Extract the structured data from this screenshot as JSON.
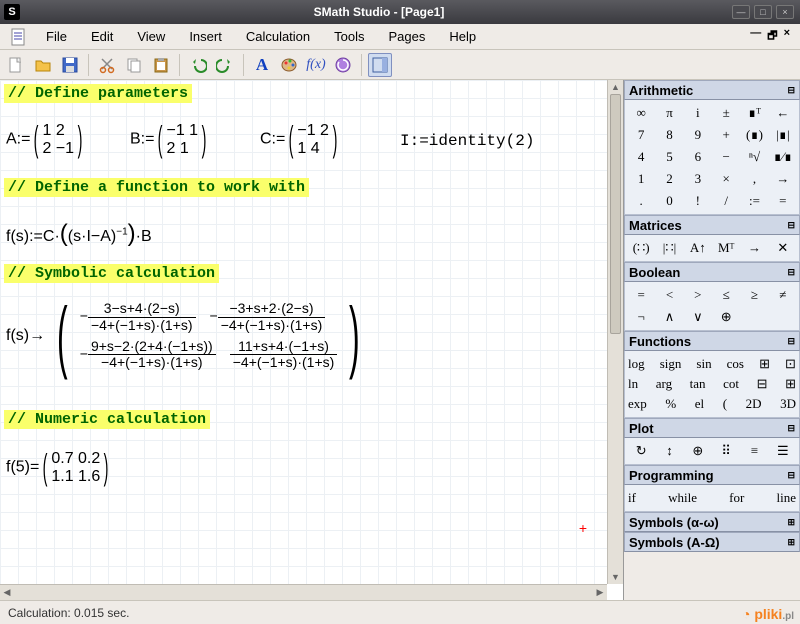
{
  "title": "SMath Studio - [Page1]",
  "menu": [
    "File",
    "Edit",
    "View",
    "Insert",
    "Calculation",
    "Tools",
    "Pages",
    "Help"
  ],
  "status": "Calculation: 0.015 sec.",
  "watermark": {
    "brand": "pliki",
    "tld": ".pl"
  },
  "comments": {
    "c1": "// Define parameters",
    "c2": "// Define a function to work with",
    "c3": "// Symbolic calculation",
    "c4": "// Numeric calculation"
  },
  "matrices": {
    "A": {
      "label": "A:=",
      "r1": "1  2",
      "r2": "2 −1"
    },
    "B": {
      "label": "B:=",
      "r1": "−1 1",
      "r2": " 2 1"
    },
    "C": {
      "label": "C:=",
      "r1": "−1 2",
      "r2": " 1 4"
    },
    "I": "I:=identity(2)"
  },
  "fdef": {
    "lhs": "f(s):=C·",
    "mid": "(s·I−A)",
    "exp": "−1",
    "tail": "·B"
  },
  "fsym": {
    "lhs": "f(s)→",
    "m11n": "3−s+4·(2−s)",
    "m11d": "−4+(−1+s)·(1+s)",
    "m11s": "−",
    "m12n": "−3+s+2·(2−s)",
    "m12d": "−4+(−1+s)·(1+s)",
    "m12s": "−",
    "m21n": "9+s−2·(2+4·(−1+s))",
    "m21d": "−4+(−1+s)·(1+s)",
    "m21s": "−",
    "m22n": "11+s+4·(−1+s)",
    "m22d": "−4+(−1+s)·(1+s)",
    "m22s": ""
  },
  "fnum": {
    "lhs": "f(5)=",
    "r1": "0.7 0.2",
    "r2": "1.1 1.6"
  },
  "palettes": {
    "arithmetic": {
      "title": "Arithmetic",
      "cells": [
        "∞",
        "π",
        "i",
        "±",
        "∎ᵀ",
        "←",
        "7",
        "8",
        "9",
        "+",
        "(∎)",
        "|∎|",
        "4",
        "5",
        "6",
        "−",
        "ⁿ√",
        "∎⁄∎",
        "1",
        "2",
        "3",
        "×",
        ",",
        "→",
        ".",
        "0",
        "!",
        "/",
        ":=",
        "="
      ]
    },
    "matrices": {
      "title": "Matrices",
      "cells": [
        "(∷)",
        "|∷|",
        "A↑",
        "Mᵀ",
        "→",
        "✕"
      ]
    },
    "boolean": {
      "title": "Boolean",
      "cells": [
        "=",
        "<",
        ">",
        "≤",
        "≥",
        "≠",
        "¬",
        "∧",
        "∨",
        "⊕",
        "",
        ""
      ]
    },
    "functions": {
      "title": "Functions",
      "rows": [
        [
          "log",
          "sign",
          "sin",
          "cos",
          "⊞",
          "⊡"
        ],
        [
          "ln",
          "arg",
          "tan",
          "cot",
          "⊟",
          "⊞"
        ],
        [
          "exp",
          "%",
          "el",
          "(",
          "2D",
          "3D"
        ]
      ]
    },
    "plot": {
      "title": "Plot",
      "cells": [
        "↻",
        "↕",
        "⊕",
        "⠿",
        "≡",
        "☰"
      ]
    },
    "programming": {
      "title": "Programming",
      "cells": [
        "if",
        "while",
        "for",
        "line"
      ]
    },
    "sym_lower": {
      "title": "Symbols (α-ω)"
    },
    "sym_upper": {
      "title": "Symbols (A-Ω)"
    }
  }
}
